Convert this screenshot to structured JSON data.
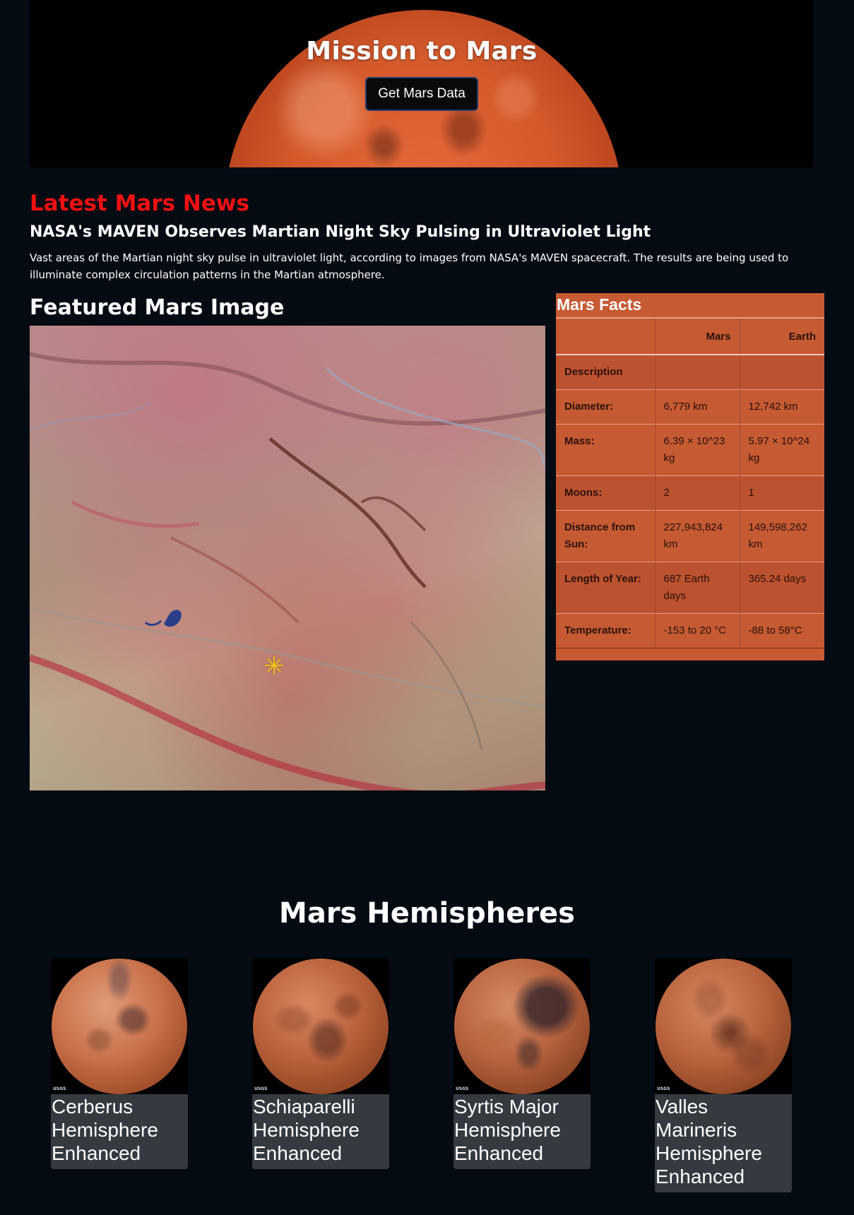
{
  "hero": {
    "title": "Mission to Mars",
    "button_label": "Get Mars Data"
  },
  "news": {
    "heading": "Latest Mars News",
    "title": "NASA's MAVEN Observes Martian Night Sky Pulsing in Ultraviolet Light",
    "paragraph": "Vast areas of the Martian night sky pulse in ultraviolet light, according to images from NASA's MAVEN spacecraft. The results are being used to illuminate complex circulation patterns in the Martian atmosphere."
  },
  "featured": {
    "heading": "Featured Mars Image"
  },
  "facts": {
    "caption": "Mars Facts",
    "columns": [
      "",
      "Mars",
      "Earth"
    ],
    "rows": [
      {
        "label": "Description",
        "mars": "",
        "earth": ""
      },
      {
        "label": "Diameter:",
        "mars": "6,779 km",
        "earth": "12,742 km"
      },
      {
        "label": "Mass:",
        "mars": "6.39 × 10^23 kg",
        "earth": "5.97 × 10^24 kg"
      },
      {
        "label": "Moons:",
        "mars": "2",
        "earth": "1"
      },
      {
        "label": "Distance from Sun:",
        "mars": "227,943,824 km",
        "earth": "149,598,262 km"
      },
      {
        "label": "Length of Year:",
        "mars": "687 Earth days",
        "earth": "365.24 days"
      },
      {
        "label": "Temperature:",
        "mars": "-153 to 20 °C",
        "earth": "-88 to 58°C"
      }
    ]
  },
  "hemispheres": {
    "heading": "Mars Hemispheres",
    "items": [
      {
        "title": "Cerberus Hemisphere Enhanced",
        "logo": "USGS"
      },
      {
        "title": "Schiaparelli Hemisphere Enhanced",
        "logo": "USGS"
      },
      {
        "title": "Syrtis Major Hemisphere Enhanced",
        "logo": "USGS"
      },
      {
        "title": "Valles Marineris Hemisphere Enhanced",
        "logo": "USGS"
      }
    ]
  },
  "colors": {
    "page_bg": "#050b13",
    "news_heading": "#ee1111",
    "facts_bg": "#c65a33",
    "card_bg": "#343a40"
  }
}
